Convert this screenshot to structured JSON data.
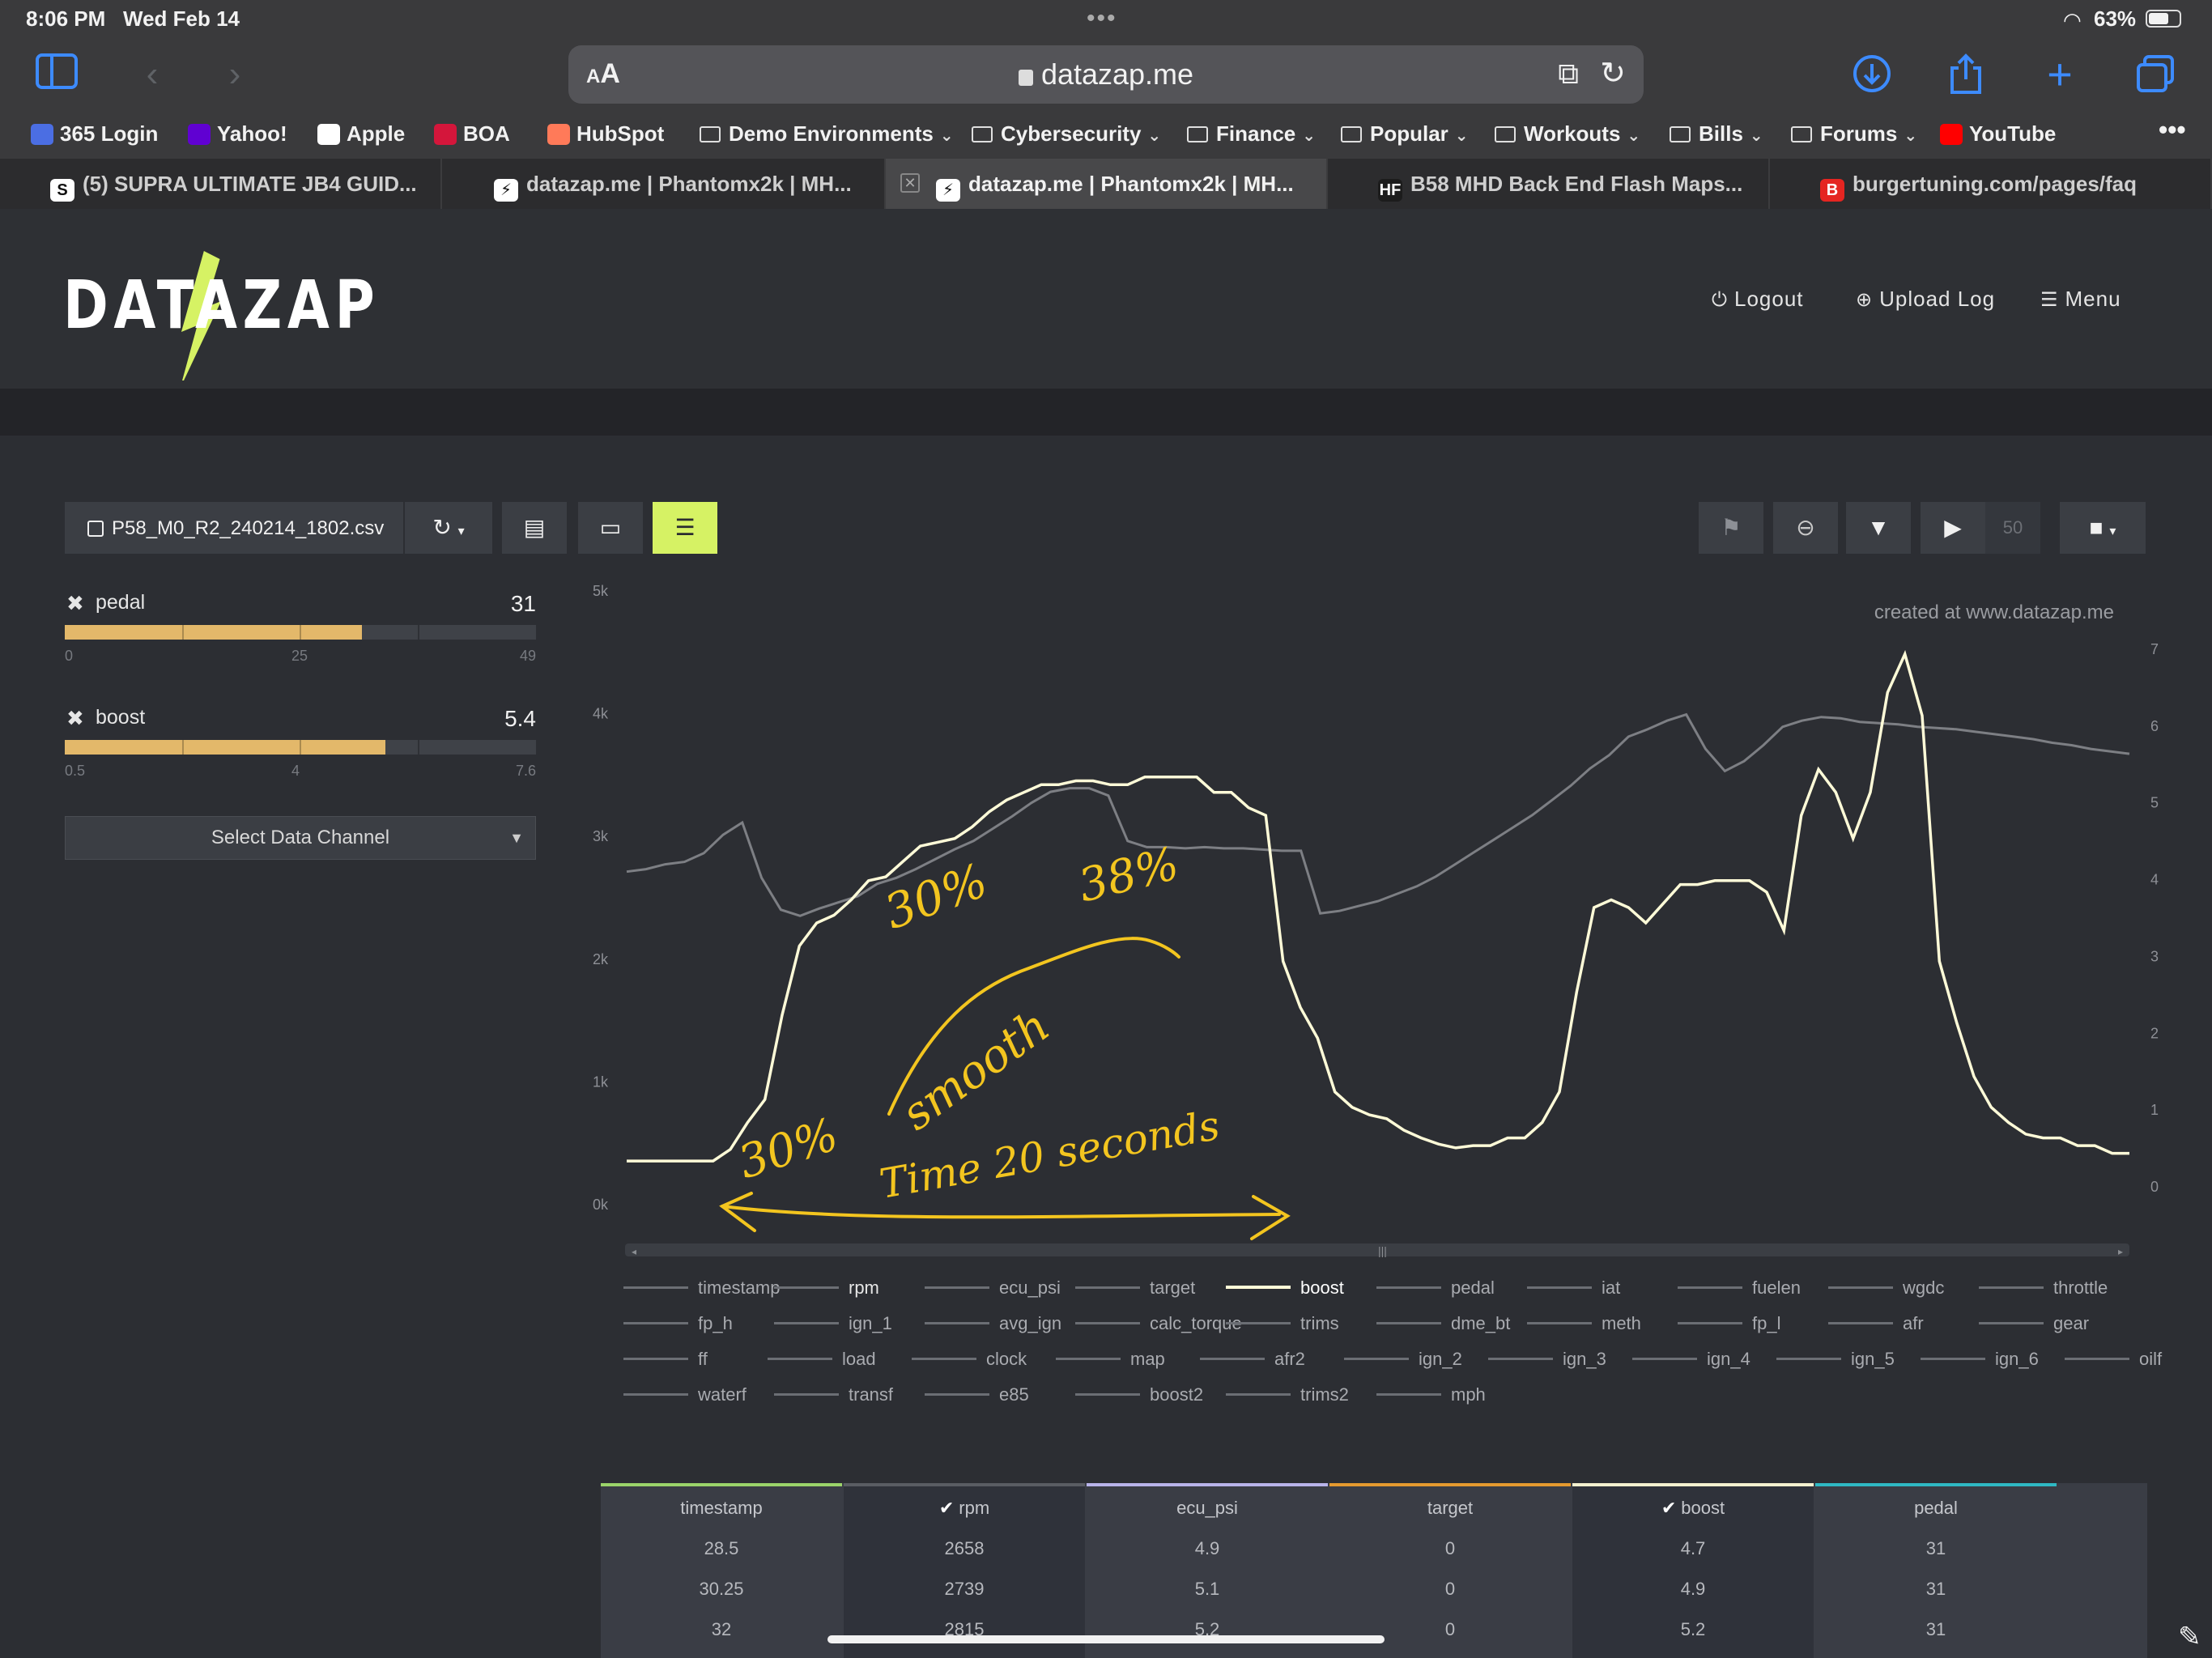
{
  "status_bar": {
    "time": "8:06 PM",
    "date": "Wed Feb 14",
    "battery": "63%"
  },
  "browser": {
    "address": "datazap.me",
    "aa_label": "AA",
    "bookmarks": [
      {
        "label": "365 Login",
        "icon": "microsoft-365-icon",
        "color": "#4b6ee3",
        "folder": false
      },
      {
        "label": "Yahoo!",
        "icon": "yahoo-icon",
        "color": "#6001d2",
        "folder": false
      },
      {
        "label": "Apple",
        "icon": "apple-icon",
        "color": "#ffffff",
        "folder": false
      },
      {
        "label": "BOA",
        "icon": "boa-icon",
        "color": "#d4163b",
        "folder": false
      },
      {
        "label": "HubSpot",
        "icon": "hubspot-icon",
        "color": "#ff7a59",
        "folder": false
      },
      {
        "label": "Demo Environments",
        "folder": true
      },
      {
        "label": "Cybersecurity",
        "folder": true
      },
      {
        "label": "Finance",
        "folder": true
      },
      {
        "label": "Popular",
        "folder": true
      },
      {
        "label": "Workouts",
        "folder": true
      },
      {
        "label": "Bills",
        "folder": true
      },
      {
        "label": "Forums",
        "folder": true
      },
      {
        "label": "YouTube",
        "icon": "youtube-icon",
        "color": "#ff0000",
        "folder": false
      }
    ],
    "tabs": [
      {
        "label": "(5) SUPRA ULTIMATE JB4 GUID...",
        "icon_text": "S",
        "active": false
      },
      {
        "label": "datazap.me | Phantomx2k | MH...",
        "icon_text": "⚡",
        "active": false
      },
      {
        "label": "datazap.me | Phantomx2k | MH...",
        "icon_text": "⚡",
        "active": true
      },
      {
        "label": "B58 MHD Back End Flash Maps...",
        "icon_text": "HF",
        "active": false
      },
      {
        "label": "burgertuning.com/pages/faq",
        "icon_text": "B",
        "active": false
      }
    ]
  },
  "site": {
    "logo": "DATAZAP",
    "nav": {
      "logout": "Logout",
      "upload": "Upload Log",
      "menu": "Menu"
    }
  },
  "toolbar": {
    "file": "P58_M0_R2_240214_1802.csv",
    "rate": "50"
  },
  "channels": [
    {
      "name": "pedal",
      "value": "31",
      "fill": 0.63,
      "min": "0",
      "mid": "25",
      "max": "49"
    },
    {
      "name": "boost",
      "value": "5.4",
      "fill": 0.68,
      "min": "0.5",
      "mid": "4",
      "max": "7.6"
    }
  ],
  "select_channel": "Select Data Channel",
  "chart_data": {
    "type": "line",
    "watermark": "created at www.datazap.me",
    "y_left_ticks": [
      "5k",
      "4k",
      "3k",
      "2k",
      "1k",
      "0k"
    ],
    "y_right_ticks": [
      "7",
      "6",
      "5",
      "4",
      "3",
      "2",
      "1",
      "0"
    ],
    "ylim_left": [
      0,
      5000
    ],
    "ylim_right": [
      0,
      8
    ],
    "series": [
      {
        "name": "rpm",
        "axis": "left",
        "color": "#7d7f84",
        "values": [
          2700,
          2720,
          2760,
          2780,
          2850,
          3000,
          3100,
          2650,
          2390,
          2340,
          2400,
          2450,
          2500,
          2600,
          2650,
          2720,
          2800,
          2880,
          2950,
          3050,
          3150,
          3260,
          3350,
          3380,
          3380,
          3320,
          2950,
          2900,
          2900,
          2890,
          2900,
          2890,
          2890,
          2880,
          2870,
          2870,
          2360,
          2380,
          2420,
          2460,
          2520,
          2580,
          2660,
          2760,
          2860,
          2960,
          3060,
          3160,
          3280,
          3400,
          3540,
          3650,
          3800,
          3860,
          3930,
          3980,
          3700,
          3520,
          3600,
          3730,
          3880,
          3930,
          3960,
          3950,
          3920,
          3910,
          3900,
          3880,
          3870,
          3860,
          3840,
          3820,
          3800,
          3780,
          3750,
          3730,
          3700,
          3680,
          3660
        ]
      },
      {
        "name": "boost",
        "axis": "right",
        "color": "#fffbd8",
        "values": [
          0.4,
          0.4,
          0.4,
          0.4,
          0.4,
          0.4,
          0.55,
          0.9,
          1.2,
          2.3,
          3.2,
          3.5,
          3.6,
          3.8,
          4.05,
          4.1,
          4.3,
          4.5,
          4.55,
          4.6,
          4.75,
          4.95,
          5.1,
          5.2,
          5.3,
          5.3,
          5.35,
          5.35,
          5.3,
          5.3,
          5.4,
          5.4,
          5.4,
          5.4,
          5.2,
          5.2,
          5.0,
          4.9,
          3.0,
          2.4,
          2.0,
          1.3,
          1.1,
          1.0,
          0.95,
          0.8,
          0.7,
          0.62,
          0.57,
          0.6,
          0.6,
          0.7,
          0.7,
          0.9,
          1.3,
          2.6,
          3.7,
          3.8,
          3.7,
          3.5,
          3.75,
          4.0,
          4.0,
          4.05,
          4.05,
          4.05,
          3.9,
          3.4,
          4.9,
          5.5,
          5.2,
          4.6,
          5.2,
          6.5,
          7.0,
          6.2,
          3.0,
          2.2,
          1.5,
          1.1,
          0.9,
          0.75,
          0.7,
          0.7,
          0.6,
          0.6,
          0.5,
          0.5
        ]
      }
    ]
  },
  "annotations": {
    "a1": "30%",
    "a2": "30%",
    "a3": "38%",
    "a4": "smooth",
    "a5": "Time 20 seconds"
  },
  "legend": [
    [
      "timestamp",
      "rpm",
      "ecu_psi",
      "target",
      "boost",
      "pedal",
      "iat",
      "fuelen",
      "wgdc",
      "throttle"
    ],
    [
      "fp_h",
      "ign_1",
      "avg_ign",
      "calc_torque",
      "trims",
      "dme_bt",
      "meth",
      "fp_l",
      "afr",
      "gear"
    ],
    [
      "ff",
      "load",
      "clock",
      "map",
      "afr2",
      "ign_2",
      "ign_3",
      "ign_4",
      "ign_5",
      "ign_6",
      "oilf"
    ],
    [
      "waterf",
      "transf",
      "e85",
      "boost2",
      "trims2",
      "mph"
    ]
  ],
  "legend_selected": [
    "rpm",
    "boost"
  ],
  "table": {
    "columns": [
      {
        "name": "timestamp",
        "color": "#9bd46a",
        "checked": false,
        "cells": [
          "28.5",
          "30.25",
          "32"
        ]
      },
      {
        "name": "rpm",
        "color": "#5a5d63",
        "checked": true,
        "cells": [
          "2658",
          "2739",
          "2815"
        ]
      },
      {
        "name": "ecu_psi",
        "color": "#b9b4ea",
        "checked": false,
        "cells": [
          "4.9",
          "5.1",
          "5.2"
        ]
      },
      {
        "name": "target",
        "color": "#e59a2f",
        "checked": false,
        "cells": [
          "0",
          "0",
          "0"
        ]
      },
      {
        "name": "boost",
        "color": "#f4f1cf",
        "checked": true,
        "cells": [
          "4.7",
          "4.9",
          "5.2"
        ]
      },
      {
        "name": "pedal",
        "color": "#2fb9c4",
        "checked": false,
        "cells": [
          "31",
          "31",
          "31"
        ]
      }
    ]
  }
}
